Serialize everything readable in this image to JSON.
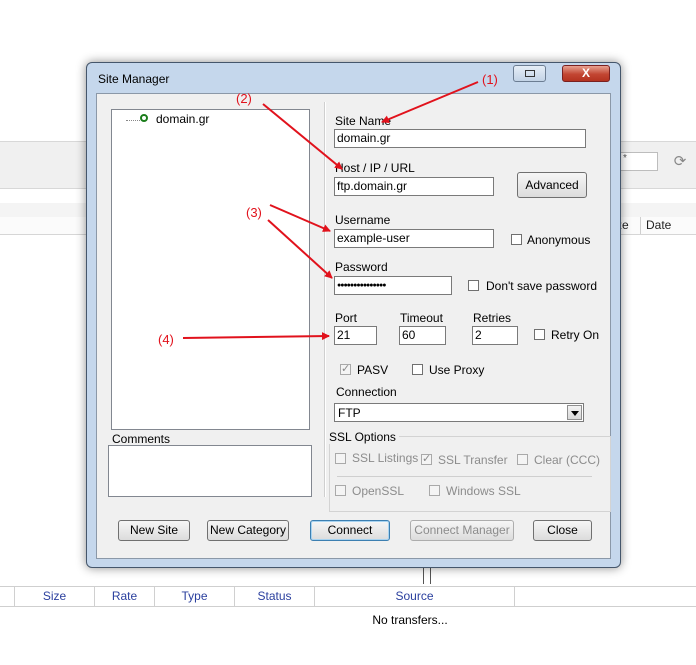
{
  "background": {
    "search_value": "*",
    "refresh_icon": "refresh-icon",
    "file_columns": [
      "ze",
      "Date"
    ],
    "queue_columns": [
      "Size",
      "Rate",
      "Type",
      "Status",
      "Source"
    ],
    "queue_empty": "No transfers..."
  },
  "dialog": {
    "title": "Site Manager",
    "close_label": "X",
    "tree": {
      "items": [
        {
          "label": "domain.gr",
          "icon": "site-globe-icon"
        }
      ]
    },
    "comments_label": "Comments",
    "site_name_label": "Site Name",
    "site_name_value": "domain.gr",
    "host_label": "Host / IP / URL",
    "host_value": "ftp.domain.gr",
    "advanced_label": "Advanced",
    "username_label": "Username",
    "username_value": "example-user",
    "anonymous_label": "Anonymous",
    "password_label": "Password",
    "password_value": "●●●●●●●●●●●●●●●",
    "dont_save_label": "Don't save password",
    "port_label": "Port",
    "port_value": "21",
    "timeout_label": "Timeout",
    "timeout_value": "60",
    "retries_label": "Retries",
    "retries_value": "2",
    "retry_on_label": "Retry On",
    "pasv_label": "PASV",
    "use_proxy_label": "Use Proxy",
    "connection_label": "Connection",
    "connection_value": "FTP",
    "ssl_options_label": "SSL Options",
    "ssl_listings_label": "SSL Listings",
    "ssl_transfer_label": "SSL Transfer",
    "clear_ccc_label": "Clear (CCC)",
    "openssl_label": "OpenSSL",
    "windows_ssl_label": "Windows SSL",
    "buttons": {
      "new_site": "New Site",
      "new_category": "New Category",
      "connect": "Connect",
      "connect_manager": "Connect Manager",
      "close": "Close"
    }
  },
  "annotations": {
    "a1": "(1)",
    "a2": "(2)",
    "a3": "(3)",
    "a4": "(4)",
    "color": "#e1121c"
  }
}
